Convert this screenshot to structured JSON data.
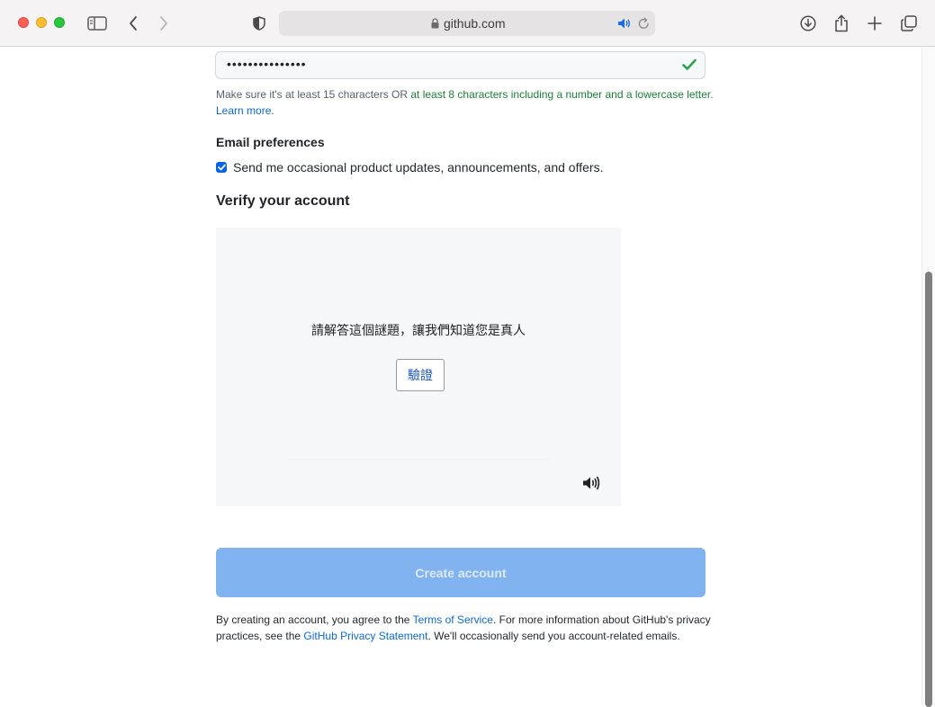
{
  "browser": {
    "url": "github.com"
  },
  "password": {
    "masked_value": "•••••••••••••••",
    "hint_prefix": "Make sure it's at least 15 characters OR ",
    "hint_green": "at least 8 characters including a number and a lowercase letter",
    "hint_period": ".",
    "hint_link": "Learn more",
    "hint_end": "."
  },
  "email_preferences": {
    "heading": "Email preferences",
    "checkbox_checked": true,
    "checkbox_label": "Send me occasional product updates, announcements, and offers."
  },
  "verify": {
    "heading": "Verify your account",
    "captcha_prompt": "請解答這個謎題，讓我們知道您是真人",
    "captcha_button": "驗證"
  },
  "create_account": {
    "button_label": "Create account"
  },
  "terms": {
    "text_1": "By creating an account, you agree to the ",
    "link_tos": "Terms of Service",
    "text_2": ". For more information about GitHub's privacy practices, see the ",
    "link_privacy": "GitHub Privacy Statement",
    "text_3": ". We'll occasionally send you account-related emails."
  },
  "colors": {
    "accent_blue": "#0969da",
    "success_green": "#1a7f37",
    "disabled_button": "#80b3f0"
  }
}
